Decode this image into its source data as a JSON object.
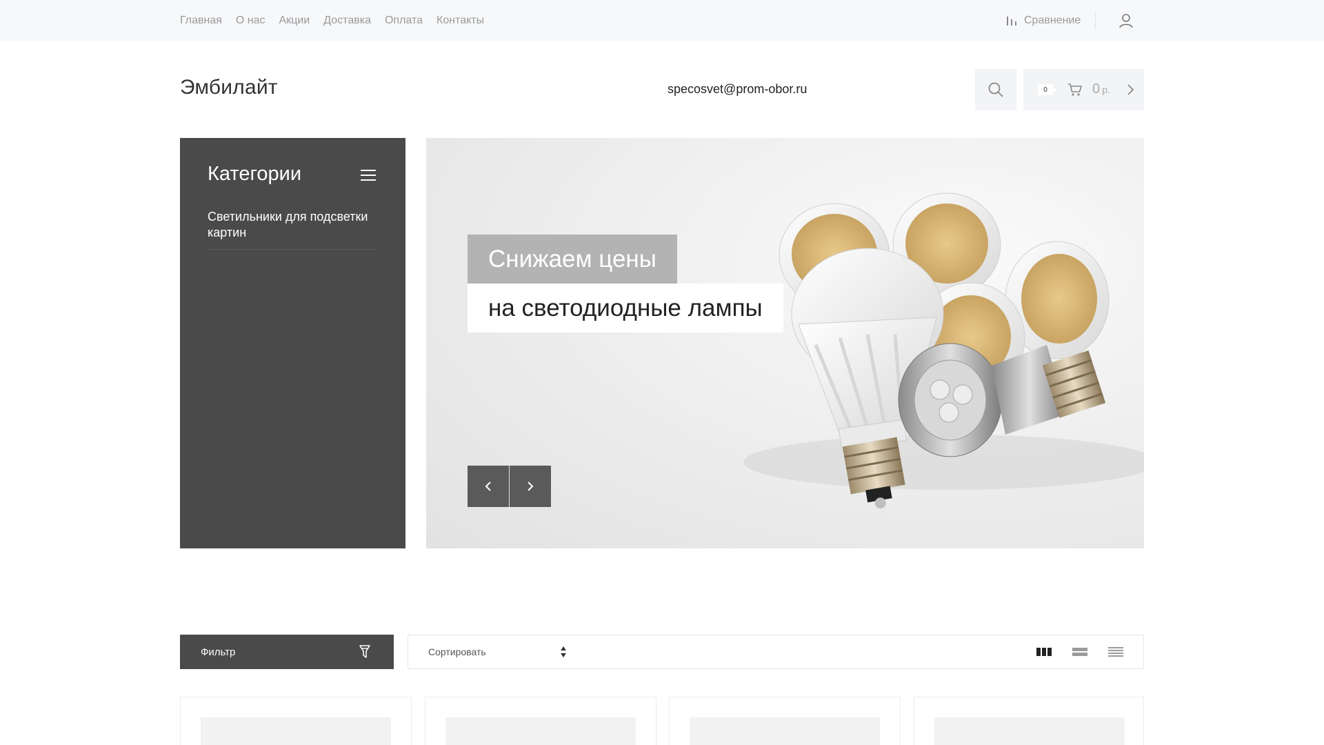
{
  "topnav": {
    "items": [
      "Главная",
      "О нас",
      "Акции",
      "Доставка",
      "Оплата",
      "Контакты"
    ],
    "compare_label": "Сравнение"
  },
  "header": {
    "logo": "Эмбилайт",
    "email": "specosvet@prom-obor.ru",
    "cart_count": "0",
    "cart_sum": "0",
    "cart_currency": "р."
  },
  "sidebar": {
    "title": "Категории",
    "items": [
      {
        "label": "Светильники для подсветки картин"
      }
    ]
  },
  "banner": {
    "caption_line1": "Снижаем цены",
    "caption_line2": "на светодиодные лампы"
  },
  "catalog": {
    "filter_label": "Фильтр",
    "sort_label": "Сортировать",
    "views": [
      "grid-view-icon",
      "list-view-icon",
      "table-view-icon"
    ],
    "active_view": "grid-view-icon"
  },
  "colors": {
    "topbar_bg": "#f7f8fa",
    "sidebar_bg": "#4a4a4a",
    "accent_gray": "#b3b3b3"
  }
}
